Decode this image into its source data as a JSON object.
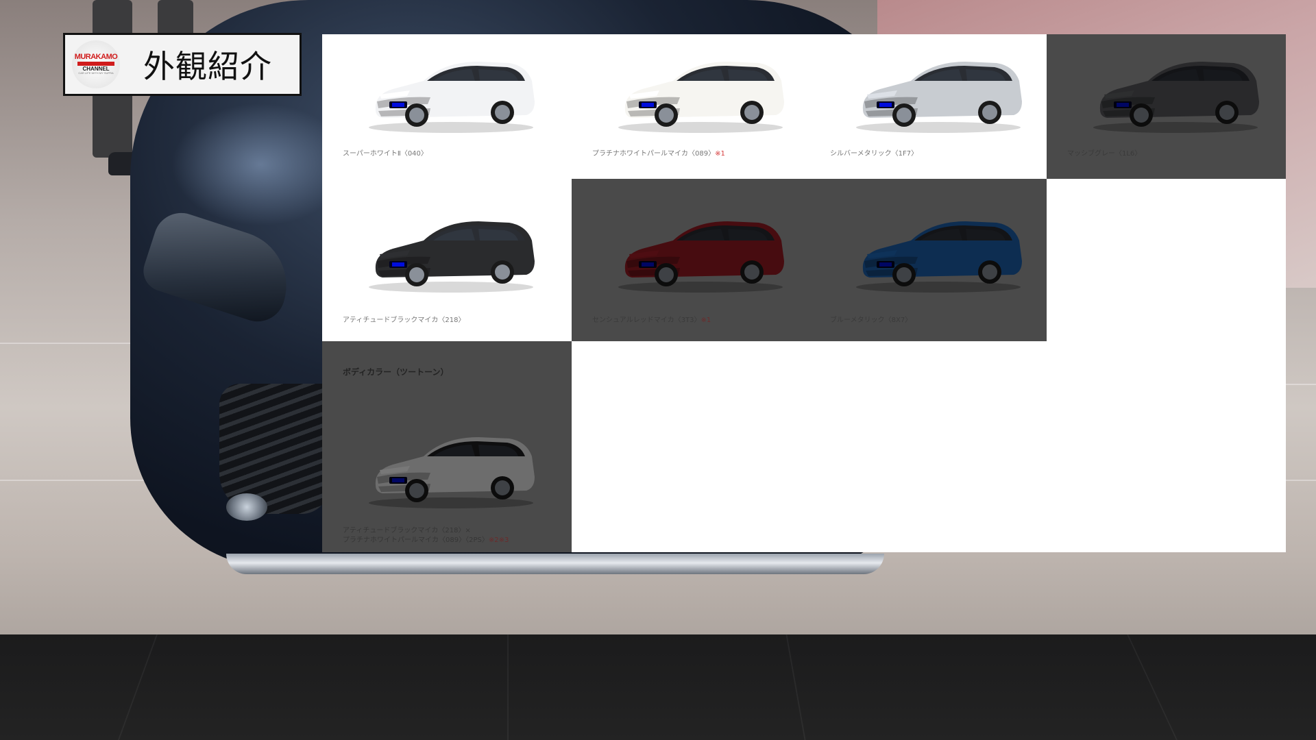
{
  "title_badge": {
    "logo": {
      "line1": "MURAKAMO",
      "line2": "CHANNEL",
      "line3": "CAR LIFE WITH MY SUPRA"
    },
    "title": "外観紹介"
  },
  "colors": {
    "row1": [
      {
        "label": "スーパーホワイトⅡ〈040〉",
        "note": "",
        "body_color": "#f2f3f5",
        "dimmed": false
      },
      {
        "label": "プラチナホワイトパールマイカ〈089〉",
        "note": "※1",
        "body_color": "#f6f5f1",
        "dimmed": false
      },
      {
        "label": "シルバーメタリック〈1F7〉",
        "note": "",
        "body_color": "#c8ccd1",
        "dimmed": false
      },
      {
        "label": "マッシブグレー〈1L6〉",
        "note": "",
        "body_color": "#5a5c5f",
        "dimmed": true
      }
    ],
    "row2": [
      {
        "label": "アティチュードブラックマイカ〈218〉",
        "note": "",
        "body_color": "#2a2b2d",
        "dimmed": false
      },
      {
        "label": "センシュアルレッドマイカ〈3T3〉",
        "note": "※1",
        "body_color": "#9e1b24",
        "dimmed": true
      },
      {
        "label": "ブルーメタリック〈8X7〉",
        "note": "",
        "body_color": "#1d64b4",
        "dimmed": true
      }
    ],
    "two_tone": {
      "heading": "ボディカラー（ツートーン）",
      "line1": "アティチュードブラックマイカ〈218〉×",
      "line2": "プラチナホワイトパールマイカ〈089〉〈2PS〉",
      "note": "※2※3",
      "body_color": "#f2f2f2",
      "roof_color": "#1e1f21",
      "dimmed": true
    }
  }
}
